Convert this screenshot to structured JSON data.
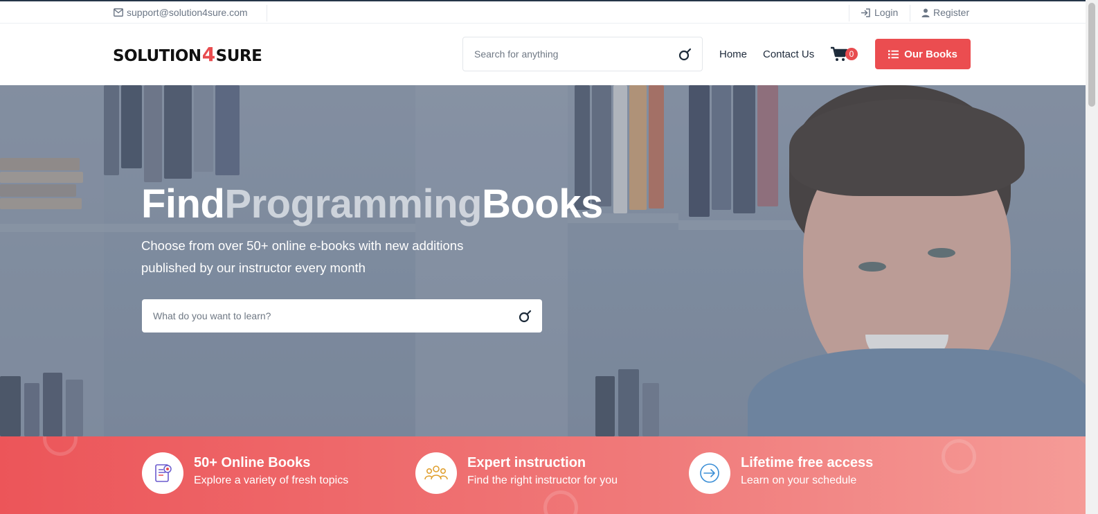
{
  "topbar": {
    "email": "support@solution4sure.com",
    "login": "Login",
    "register": "Register"
  },
  "header": {
    "logo_left": "SOLUTION",
    "logo_mid": "4",
    "logo_right": "SURE",
    "search_placeholder": "Search for anything",
    "nav_home": "Home",
    "nav_contact": "Contact Us",
    "cart_count": "0",
    "books_button": "Our Books"
  },
  "hero": {
    "title_word1": "Find",
    "title_word2": "Programming",
    "title_word3": "Books",
    "subtitle_line1": "Choose from over 50+ online e-books with new additions",
    "subtitle_line2": "published by our instructor every month",
    "search_placeholder": "What do you want to learn?"
  },
  "features": [
    {
      "title": "50+ Online Books",
      "desc": "Explore a variety of fresh topics",
      "icon": "ebook-icon"
    },
    {
      "title": "Expert instruction",
      "desc": "Find the right instructor for you",
      "icon": "group-icon"
    },
    {
      "title": "Lifetime free access",
      "desc": "Learn on your schedule",
      "icon": "arrow-circle-icon"
    }
  ],
  "colors": {
    "brand_red": "#eb4d50",
    "dark_navy": "#1d2b3a",
    "muted_text": "#6b7685"
  }
}
